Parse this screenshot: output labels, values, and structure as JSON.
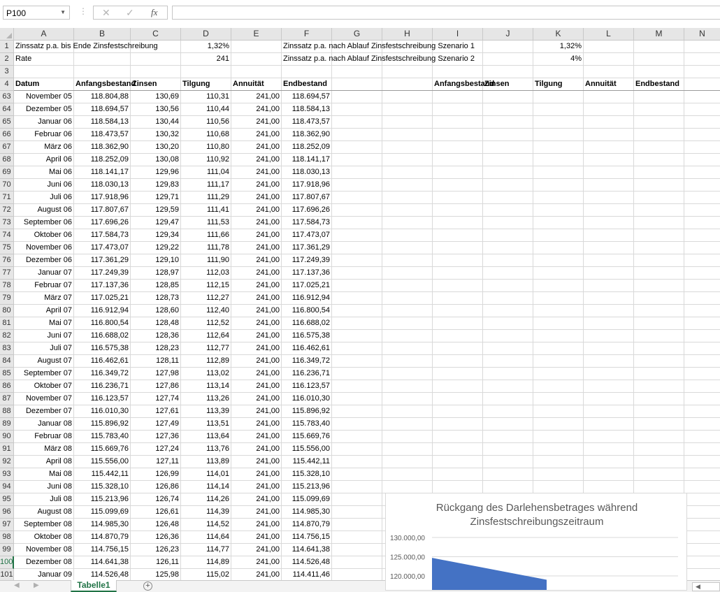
{
  "formula_bar": {
    "name_box": "P100",
    "formula": "",
    "cancel_icon": "✕",
    "enter_icon": "✓",
    "fx_label": "fx"
  },
  "columns": [
    "A",
    "B",
    "C",
    "D",
    "E",
    "F",
    "G",
    "H",
    "I",
    "J",
    "K",
    "L",
    "M",
    "N"
  ],
  "top_rows": [
    {
      "num": "1",
      "cells": {
        "A": "Zinssatz p.a. bis Ende Zinsfestschreibung",
        "D": "1,32%",
        "F": "Zinssatz p.a. nach Ablauf Zinsfestschreibung Szenario 1",
        "K": "1,32%"
      }
    },
    {
      "num": "2",
      "cells": {
        "A": "Rate",
        "D": "241",
        "F": "Zinssatz p.a. nach Ablauf Zinsfestschreibung Szenario 2",
        "K": "4%"
      }
    },
    {
      "num": "3",
      "cells": {}
    },
    {
      "num": "4",
      "cells": {
        "A": "Datum",
        "B": "Anfangsbestand",
        "C": "Zinsen",
        "D": "Tilgung",
        "E": "Annuität",
        "F": "Endbestand",
        "I": "Anfangsbestand",
        "J": "Zinsen",
        "K": "Tilgung",
        "L": "Annuität",
        "M": "Endbestand"
      }
    }
  ],
  "data_rows": [
    [
      "63",
      "November 05",
      "118.804,88",
      "130,69",
      "110,31",
      "241,00",
      "118.694,57"
    ],
    [
      "64",
      "Dezember 05",
      "118.694,57",
      "130,56",
      "110,44",
      "241,00",
      "118.584,13"
    ],
    [
      "65",
      "Januar 06",
      "118.584,13",
      "130,44",
      "110,56",
      "241,00",
      "118.473,57"
    ],
    [
      "66",
      "Februar 06",
      "118.473,57",
      "130,32",
      "110,68",
      "241,00",
      "118.362,90"
    ],
    [
      "67",
      "März 06",
      "118.362,90",
      "130,20",
      "110,80",
      "241,00",
      "118.252,09"
    ],
    [
      "68",
      "April 06",
      "118.252,09",
      "130,08",
      "110,92",
      "241,00",
      "118.141,17"
    ],
    [
      "69",
      "Mai 06",
      "118.141,17",
      "129,96",
      "111,04",
      "241,00",
      "118.030,13"
    ],
    [
      "70",
      "Juni 06",
      "118.030,13",
      "129,83",
      "111,17",
      "241,00",
      "117.918,96"
    ],
    [
      "71",
      "Juli 06",
      "117.918,96",
      "129,71",
      "111,29",
      "241,00",
      "117.807,67"
    ],
    [
      "72",
      "August 06",
      "117.807,67",
      "129,59",
      "111,41",
      "241,00",
      "117.696,26"
    ],
    [
      "73",
      "September 06",
      "117.696,26",
      "129,47",
      "111,53",
      "241,00",
      "117.584,73"
    ],
    [
      "74",
      "Oktober 06",
      "117.584,73",
      "129,34",
      "111,66",
      "241,00",
      "117.473,07"
    ],
    [
      "75",
      "November 06",
      "117.473,07",
      "129,22",
      "111,78",
      "241,00",
      "117.361,29"
    ],
    [
      "76",
      "Dezember 06",
      "117.361,29",
      "129,10",
      "111,90",
      "241,00",
      "117.249,39"
    ],
    [
      "77",
      "Januar 07",
      "117.249,39",
      "128,97",
      "112,03",
      "241,00",
      "117.137,36"
    ],
    [
      "78",
      "Februar 07",
      "117.137,36",
      "128,85",
      "112,15",
      "241,00",
      "117.025,21"
    ],
    [
      "79",
      "März 07",
      "117.025,21",
      "128,73",
      "112,27",
      "241,00",
      "116.912,94"
    ],
    [
      "80",
      "April 07",
      "116.912,94",
      "128,60",
      "112,40",
      "241,00",
      "116.800,54"
    ],
    [
      "81",
      "Mai 07",
      "116.800,54",
      "128,48",
      "112,52",
      "241,00",
      "116.688,02"
    ],
    [
      "82",
      "Juni 07",
      "116.688,02",
      "128,36",
      "112,64",
      "241,00",
      "116.575,38"
    ],
    [
      "83",
      "Juli 07",
      "116.575,38",
      "128,23",
      "112,77",
      "241,00",
      "116.462,61"
    ],
    [
      "84",
      "August 07",
      "116.462,61",
      "128,11",
      "112,89",
      "241,00",
      "116.349,72"
    ],
    [
      "85",
      "September 07",
      "116.349,72",
      "127,98",
      "113,02",
      "241,00",
      "116.236,71"
    ],
    [
      "86",
      "Oktober 07",
      "116.236,71",
      "127,86",
      "113,14",
      "241,00",
      "116.123,57"
    ],
    [
      "87",
      "November 07",
      "116.123,57",
      "127,74",
      "113,26",
      "241,00",
      "116.010,30"
    ],
    [
      "88",
      "Dezember 07",
      "116.010,30",
      "127,61",
      "113,39",
      "241,00",
      "115.896,92"
    ],
    [
      "89",
      "Januar 08",
      "115.896,92",
      "127,49",
      "113,51",
      "241,00",
      "115.783,40"
    ],
    [
      "90",
      "Februar 08",
      "115.783,40",
      "127,36",
      "113,64",
      "241,00",
      "115.669,76"
    ],
    [
      "91",
      "März 08",
      "115.669,76",
      "127,24",
      "113,76",
      "241,00",
      "115.556,00"
    ],
    [
      "92",
      "April 08",
      "115.556,00",
      "127,11",
      "113,89",
      "241,00",
      "115.442,11"
    ],
    [
      "93",
      "Mai 08",
      "115.442,11",
      "126,99",
      "114,01",
      "241,00",
      "115.328,10"
    ],
    [
      "94",
      "Juni 08",
      "115.328,10",
      "126,86",
      "114,14",
      "241,00",
      "115.213,96"
    ],
    [
      "95",
      "Juli 08",
      "115.213,96",
      "126,74",
      "114,26",
      "241,00",
      "115.099,69"
    ],
    [
      "96",
      "August 08",
      "115.099,69",
      "126,61",
      "114,39",
      "241,00",
      "114.985,30"
    ],
    [
      "97",
      "September 08",
      "114.985,30",
      "126,48",
      "114,52",
      "241,00",
      "114.870,79"
    ],
    [
      "98",
      "Oktober 08",
      "114.870,79",
      "126,36",
      "114,64",
      "241,00",
      "114.756,15"
    ],
    [
      "99",
      "November 08",
      "114.756,15",
      "126,23",
      "114,77",
      "241,00",
      "114.641,38"
    ],
    [
      "100",
      "Dezember 08",
      "114.641,38",
      "126,11",
      "114,89",
      "241,00",
      "114.526,48"
    ],
    [
      "101",
      "Januar 09",
      "114.526,48",
      "125,98",
      "115,02",
      "241,00",
      "114.411,46"
    ]
  ],
  "selected_row": "100",
  "chart_data": {
    "type": "area",
    "title": "Rückgang des Darlehensbetrages während Zinsfestschreibungszeitraum",
    "y_ticks": [
      "130.000,00",
      "125.000,00",
      "120.000,00"
    ],
    "y_tick_values": [
      130000,
      125000,
      120000
    ],
    "series": [
      {
        "values": [
          124700,
          119000
        ]
      }
    ],
    "color": "#4472c4"
  },
  "sheet_tabs": {
    "active": "Tabelle1",
    "add_label": "+"
  },
  "colors": {
    "accent": "#217346"
  }
}
